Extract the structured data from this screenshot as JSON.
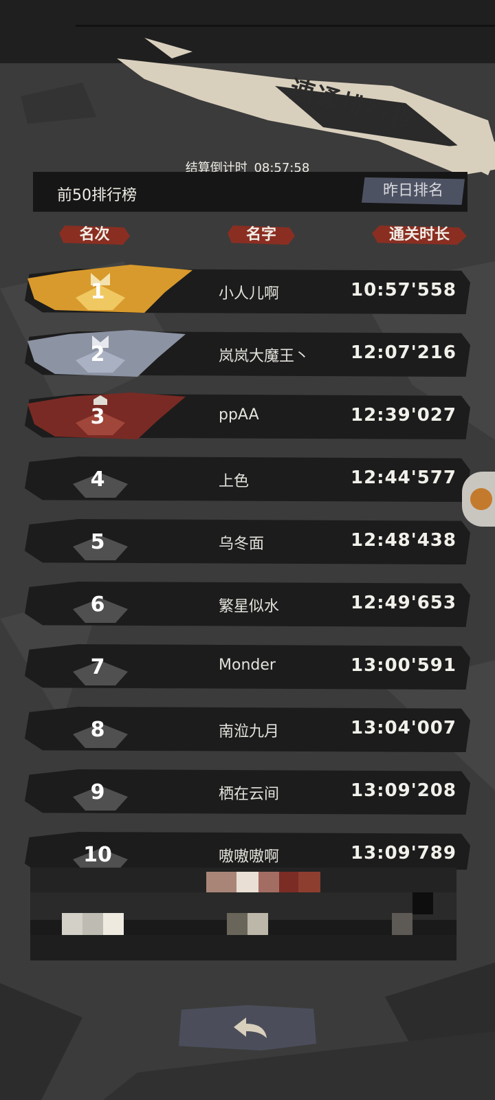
{
  "title": "速通排行榜",
  "countdown": {
    "label": "结算倒计时",
    "value": "08:57:58"
  },
  "tabs": {
    "top50": "前50排行榜",
    "yesterday": "昨日排名"
  },
  "columns": {
    "rank": "名次",
    "name": "名字",
    "time": "通关时长"
  },
  "colors": {
    "gold": "#d89a2c",
    "silver": "#8c93a3",
    "bronze": "#7a2a24",
    "row_bg": "#1c1c1c",
    "accent_red": "#8a2e22"
  },
  "rows": [
    {
      "rank": "1",
      "name": "小人儿啊",
      "time": "10:57'558",
      "medal": "gold"
    },
    {
      "rank": "2",
      "name": "岚岚大魔王丶",
      "time": "12:07'216",
      "medal": "silver"
    },
    {
      "rank": "3",
      "name": "ppAA",
      "time": "12:39'027",
      "medal": "bronze"
    },
    {
      "rank": "4",
      "name": "上色",
      "time": "12:44'577",
      "medal": "none"
    },
    {
      "rank": "5",
      "name": "乌冬面",
      "time": "12:48'438",
      "medal": "none"
    },
    {
      "rank": "6",
      "name": "繁星似水",
      "time": "12:49'653",
      "medal": "none"
    },
    {
      "rank": "7",
      "name": "Monder",
      "time": "13:00'591",
      "medal": "none"
    },
    {
      "rank": "8",
      "name": "南涖九月",
      "time": "13:04'007",
      "medal": "none"
    },
    {
      "rank": "9",
      "name": "栖在云间",
      "time": "13:09'208",
      "medal": "none"
    },
    {
      "rank": "10",
      "name": "嗷嗷嗷啊",
      "time": "13:09'789",
      "medal": "none"
    }
  ],
  "icons": {
    "back": "back-arrow-icon",
    "side_tab": "side-tab-icon"
  }
}
